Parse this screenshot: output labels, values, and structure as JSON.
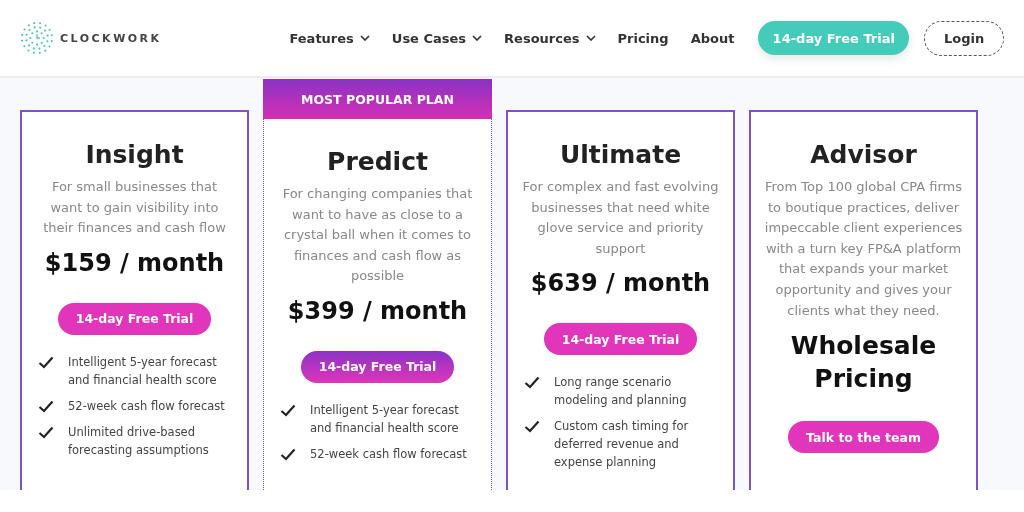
{
  "brand": {
    "name": "CLOCKWORK"
  },
  "nav": [
    {
      "label": "Features",
      "dropdown": true
    },
    {
      "label": "Use Cases",
      "dropdown": true
    },
    {
      "label": "Resources",
      "dropdown": true
    },
    {
      "label": "Pricing",
      "dropdown": false
    },
    {
      "label": "About",
      "dropdown": false
    }
  ],
  "trial_button": "14-day Free Trial",
  "login_button": "Login",
  "plans": [
    {
      "name": "Insight",
      "popular": false,
      "description": "For small businesses that want to gain visibility into their finances and cash flow",
      "kind": "price",
      "price": "$159 / month",
      "button": "14-day Free Trial",
      "features": [
        "Intelligent 5-year forecast and financial health score",
        "52-week cash flow forecast",
        "Unlimited drive-based forecasting assumptions"
      ]
    },
    {
      "name": "Predict",
      "popular": true,
      "badge": "MOST POPULAR PLAN",
      "description": "For changing companies that want to have as close to a crystal ball when it comes to finances and cash flow as possible",
      "kind": "price",
      "price": "$399 / month",
      "button": "14-day Free Trial",
      "features": [
        "Intelligent 5-year forecast and financial health score",
        "52-week cash flow forecast"
      ]
    },
    {
      "name": "Ultimate",
      "popular": false,
      "description": "For complex and fast evolving businesses that need white glove service and priority support",
      "kind": "price",
      "price": "$639 / month",
      "button": "14-day Free Trial",
      "features": [
        "Long range scenario modeling and planning",
        "Custom cash timing for deferred revenue and expense planning"
      ]
    },
    {
      "name": "Advisor",
      "popular": false,
      "description": "From Top 100 global CPA firms to boutique practices, deliver impeccable client experiences with a turn key FP&A platform that expands your market opportunity and gives your clients what they need.",
      "kind": "headline",
      "price": "Wholesale Pricing",
      "button": "Talk to the team"
    }
  ]
}
